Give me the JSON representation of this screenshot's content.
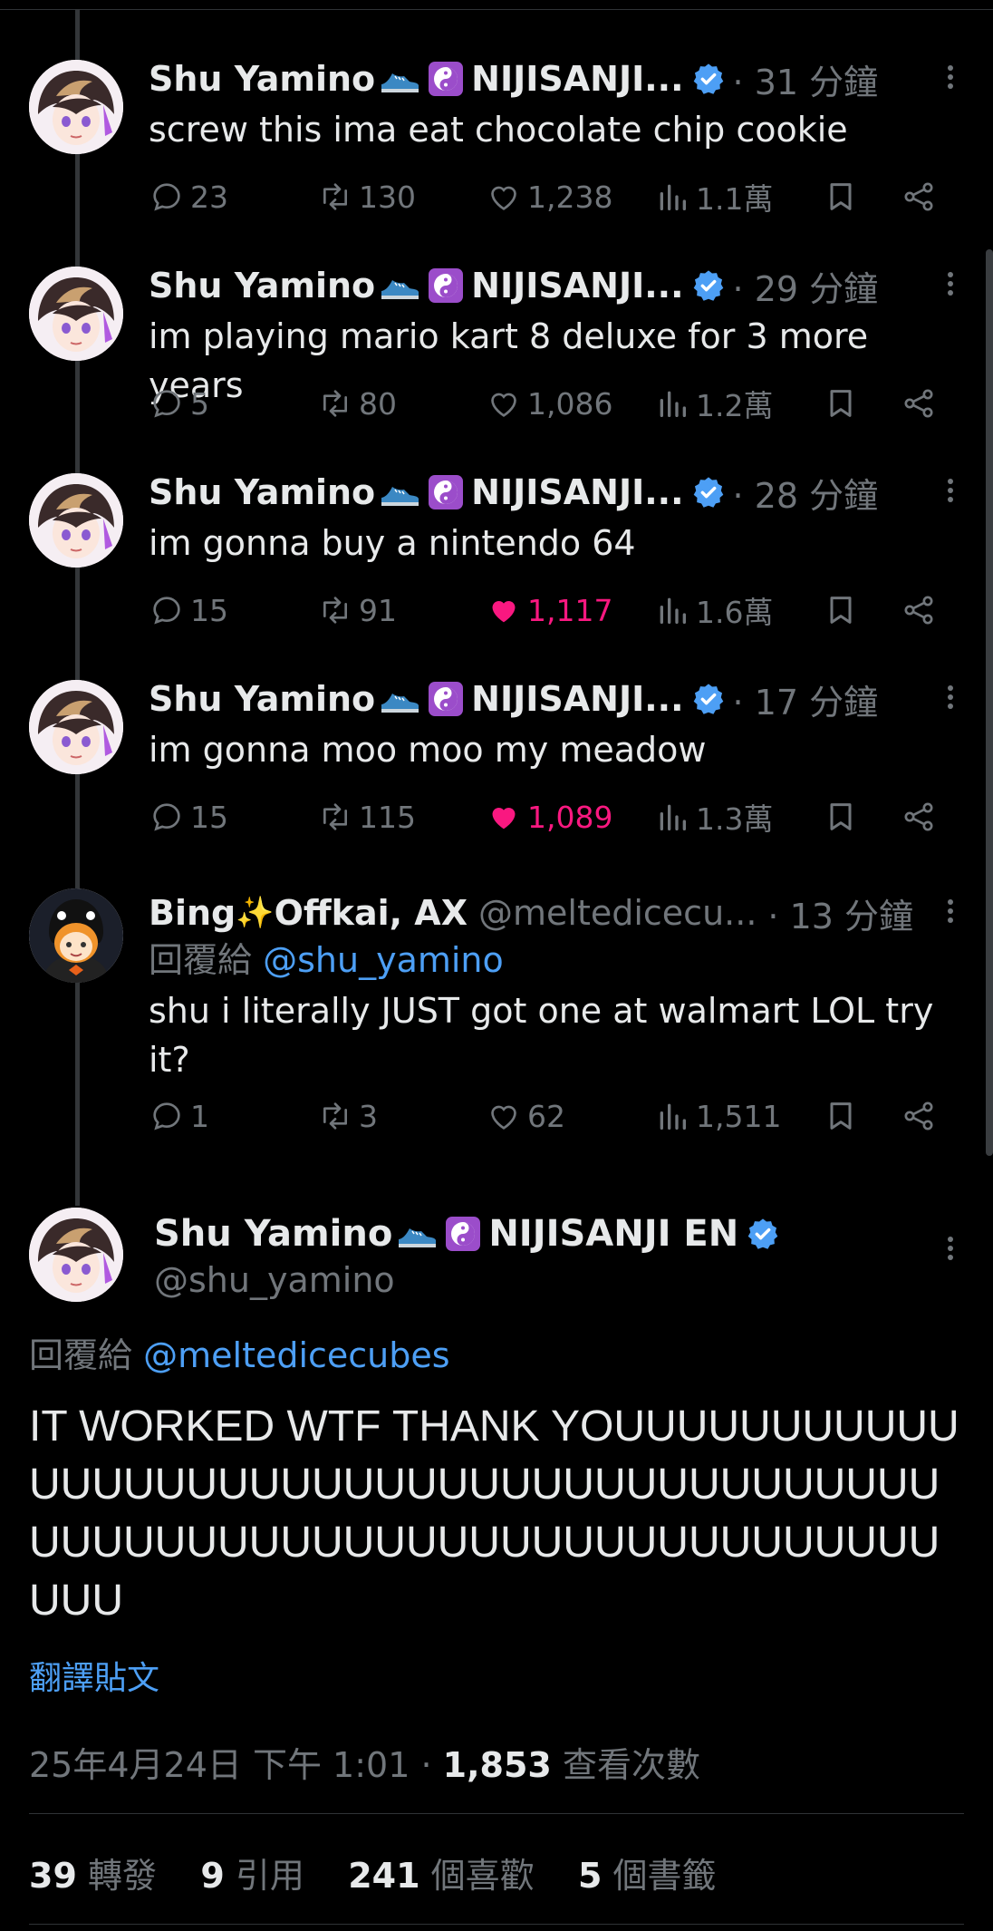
{
  "tweets": [
    {
      "display_name": "Shu Yamino",
      "name_suffix": "NIJISANJI...",
      "time": "· 31 分鐘",
      "text": "screw this ima eat chocolate chip cookie",
      "replies": "23",
      "retweets": "130",
      "likes": "1,238",
      "views": "1.1萬",
      "liked": false
    },
    {
      "display_name": "Shu Yamino",
      "name_suffix": "NIJISANJI...",
      "time": "· 29 分鐘",
      "text": "im playing mario kart 8 deluxe for 3 more years",
      "replies": "5",
      "retweets": "80",
      "likes": "1,086",
      "views": "1.2萬",
      "liked": false
    },
    {
      "display_name": "Shu Yamino",
      "name_suffix": "NIJISANJI...",
      "time": "· 28 分鐘",
      "text": "im gonna buy a nintendo 64",
      "replies": "15",
      "retweets": "91",
      "likes": "1,117",
      "views": "1.6萬",
      "liked": true
    },
    {
      "display_name": "Shu Yamino",
      "name_suffix": "NIJISANJI...",
      "time": "· 17 分鐘",
      "text": "im gonna moo moo my meadow",
      "replies": "15",
      "retweets": "115",
      "likes": "1,089",
      "views": "1.3萬",
      "liked": true
    }
  ],
  "reply_tweet": {
    "display_name": "Bing",
    "display_name_rest": "Offkai, AX",
    "handle": "@meltedicecu...",
    "time": "· 13 分鐘",
    "reply_prefix": "回覆給",
    "reply_to": "@shu_yamino",
    "text": "shu i literally JUST got one at walmart LOL try it?",
    "replies": "1",
    "retweets": "3",
    "likes": "62",
    "views": "1,511"
  },
  "focus_tweet": {
    "display_name": "Shu Yamino",
    "name_suffix": "NIJISANJI EN",
    "handle": "@shu_yamino",
    "reply_prefix": "回覆給",
    "reply_to": "@meltedicecubes",
    "text": "IT WORKED WTF THANK YOUUUUUUUUUUUUUUUUUUUUUUUUUUUUUUUUUUUUUUUUUUUUUUUUUUUUUUUUUUUUUUUUUUUUUUUU",
    "translate": "翻譯貼文",
    "date": "25年4月24日 下午 1:01",
    "views_count": "1,853",
    "views_label": "查看次數",
    "retweets": "39",
    "retweets_label": "轉發",
    "quotes": "9",
    "quotes_label": "引用",
    "likes": "241",
    "likes_label": "個喜歡",
    "bookmarks": "5",
    "bookmarks_label": "個書籤"
  },
  "colors": {
    "accent": "#4d9ff5",
    "liked": "#f91880",
    "muted": "#71767b",
    "verified": "#4d9ff5"
  }
}
